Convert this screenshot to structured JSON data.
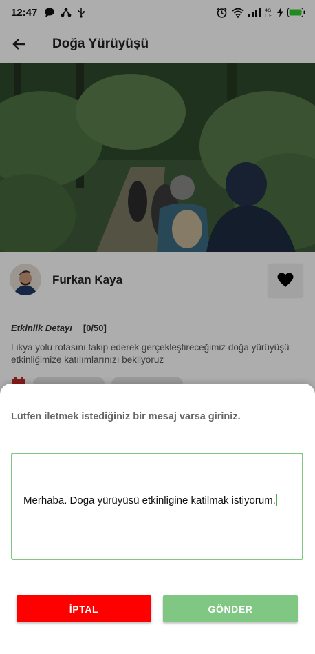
{
  "status_bar": {
    "time": "12:47",
    "left_icons": [
      "chat-icon",
      "share-icon",
      "usb-icon"
    ],
    "right_icons": [
      "alarm-icon",
      "wifi-icon",
      "signal-icon",
      "lte-icon",
      "charging-icon",
      "battery-icon"
    ]
  },
  "app_bar": {
    "back_icon": "arrow-left-icon",
    "title": "Doğa Yürüyüşü"
  },
  "owner": {
    "name": "Furkan Kaya",
    "favorite_icon": "heart-icon"
  },
  "detail": {
    "label": "Etkinlik Detayı",
    "count": "[0/50]",
    "description": "Likya yolu rotasını takip ederek gerçekleştireceğimiz doğa yürüyüşü etkinliğimize katılımlarınızı bekliyoruz"
  },
  "sheet": {
    "prompt": "Lütfen iletmek istediğiniz bir mesaj varsa giriniz.",
    "message": "Merhaba. Doga yürüyüsü etkinligine katilmak istiyorum.",
    "cancel_label": "İPTAL",
    "send_label": "GÖNDER"
  },
  "colors": {
    "cancel": "#ff0000",
    "send": "#81c784",
    "input_border": "#81c784",
    "scrim": "rgba(0,0,0,0.32)"
  }
}
